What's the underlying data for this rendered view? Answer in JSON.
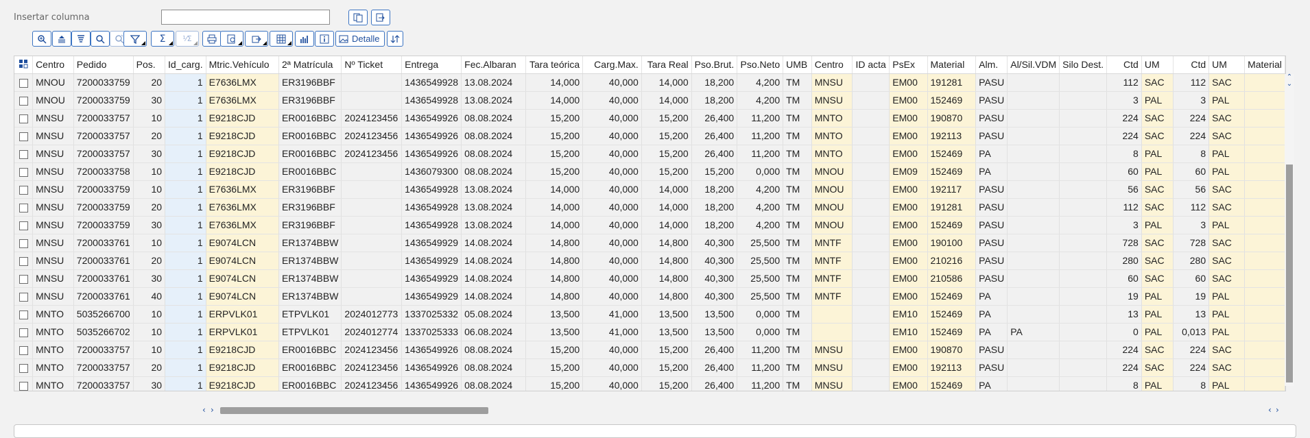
{
  "toolbar": {
    "insert_column_label": "Insertar columna",
    "insert_column_value": "",
    "detail_label": "Detalle"
  },
  "icons": {
    "copy_left": "copy-icon",
    "copy_right": "paste-icon",
    "zoom": "zoom-icon",
    "sort_asc": "sort-ascending-icon",
    "sort_desc": "sort-descending-icon",
    "find": "find-icon",
    "find_next": "find-next-icon",
    "filter": "filter-icon",
    "sum": "sum-icon",
    "subtotal": "subtotal-icon",
    "print": "print-icon",
    "print_preview": "print-preview-icon",
    "export": "export-icon",
    "layout": "layout-icon",
    "chart": "chart-icon",
    "info": "info-icon",
    "detail": "detail-icon",
    "more": "more-icon"
  },
  "grid": {
    "columns": [
      "Centro",
      "Pedido",
      "Pos.",
      "Id_carg.",
      "Mtric.Vehículo",
      "2ª Matrícula",
      "Nº Ticket",
      "Entrega",
      "Fec.Albaran",
      "Tara teórica",
      "Carg.Max.",
      "Tara Real",
      "Pso.Brut.",
      "Pso.Neto",
      "UMB",
      "Centro",
      "ID acta",
      "PsEx",
      "Material",
      "Alm.",
      "Al/Sil.VDM",
      "Silo Dest.",
      "Ctd",
      "UM",
      "Ctd",
      "UM",
      "Material"
    ],
    "rows": [
      [
        "MNOU",
        "7200033759",
        "20",
        "1",
        "E7636LMX",
        "ER3196BBF",
        "",
        "1436549928",
        "13.08.2024",
        "14,000",
        "40,000",
        "14,000",
        "18,200",
        "4,200",
        "TM",
        "MNSU",
        "",
        "EM00",
        "191281",
        "PASU",
        "",
        "",
        "112",
        "SAC",
        "112",
        "SAC",
        ""
      ],
      [
        "MNOU",
        "7200033759",
        "30",
        "1",
        "E7636LMX",
        "ER3196BBF",
        "",
        "1436549928",
        "13.08.2024",
        "14,000",
        "40,000",
        "14,000",
        "18,200",
        "4,200",
        "TM",
        "MNSU",
        "",
        "EM00",
        "152469",
        "PASU",
        "",
        "",
        "3",
        "PAL",
        "3",
        "PAL",
        ""
      ],
      [
        "MNSU",
        "7200033757",
        "10",
        "1",
        "E9218CJD",
        "ER0016BBC",
        "2024123456",
        "1436549926",
        "08.08.2024",
        "15,200",
        "40,000",
        "15,200",
        "26,400",
        "11,200",
        "TM",
        "MNTO",
        "",
        "EM00",
        "190870",
        "PASU",
        "",
        "",
        "224",
        "SAC",
        "224",
        "SAC",
        ""
      ],
      [
        "MNSU",
        "7200033757",
        "20",
        "1",
        "E9218CJD",
        "ER0016BBC",
        "2024123456",
        "1436549926",
        "08.08.2024",
        "15,200",
        "40,000",
        "15,200",
        "26,400",
        "11,200",
        "TM",
        "MNTO",
        "",
        "EM00",
        "192113",
        "PASU",
        "",
        "",
        "224",
        "SAC",
        "224",
        "SAC",
        ""
      ],
      [
        "MNSU",
        "7200033757",
        "30",
        "1",
        "E9218CJD",
        "ER0016BBC",
        "2024123456",
        "1436549926",
        "08.08.2024",
        "15,200",
        "40,000",
        "15,200",
        "26,400",
        "11,200",
        "TM",
        "MNTO",
        "",
        "EM00",
        "152469",
        "PA",
        "",
        "",
        "8",
        "PAL",
        "8",
        "PAL",
        ""
      ],
      [
        "MNSU",
        "7200033758",
        "10",
        "1",
        "E9218CJD",
        "ER0016BBC",
        "",
        "1436079300",
        "08.08.2024",
        "15,200",
        "40,000",
        "15,200",
        "15,200",
        "0,000",
        "TM",
        "MNOU",
        "",
        "EM09",
        "152469",
        "PA",
        "",
        "",
        "60",
        "PAL",
        "60",
        "PAL",
        ""
      ],
      [
        "MNSU",
        "7200033759",
        "10",
        "1",
        "E7636LMX",
        "ER3196BBF",
        "",
        "1436549928",
        "13.08.2024",
        "14,000",
        "40,000",
        "14,000",
        "18,200",
        "4,200",
        "TM",
        "MNOU",
        "",
        "EM00",
        "192117",
        "PASU",
        "",
        "",
        "56",
        "SAC",
        "56",
        "SAC",
        ""
      ],
      [
        "MNSU",
        "7200033759",
        "20",
        "1",
        "E7636LMX",
        "ER3196BBF",
        "",
        "1436549928",
        "13.08.2024",
        "14,000",
        "40,000",
        "14,000",
        "18,200",
        "4,200",
        "TM",
        "MNOU",
        "",
        "EM00",
        "191281",
        "PASU",
        "",
        "",
        "112",
        "SAC",
        "112",
        "SAC",
        ""
      ],
      [
        "MNSU",
        "7200033759",
        "30",
        "1",
        "E7636LMX",
        "ER3196BBF",
        "",
        "1436549928",
        "13.08.2024",
        "14,000",
        "40,000",
        "14,000",
        "18,200",
        "4,200",
        "TM",
        "MNOU",
        "",
        "EM00",
        "152469",
        "PASU",
        "",
        "",
        "3",
        "PAL",
        "3",
        "PAL",
        ""
      ],
      [
        "MNSU",
        "7200033761",
        "10",
        "1",
        "E9074LCN",
        "ER1374BBW",
        "",
        "1436549929",
        "14.08.2024",
        "14,800",
        "40,000",
        "14,800",
        "40,300",
        "25,500",
        "TM",
        "MNTF",
        "",
        "EM00",
        "190100",
        "PASU",
        "",
        "",
        "728",
        "SAC",
        "728",
        "SAC",
        ""
      ],
      [
        "MNSU",
        "7200033761",
        "20",
        "1",
        "E9074LCN",
        "ER1374BBW",
        "",
        "1436549929",
        "14.08.2024",
        "14,800",
        "40,000",
        "14,800",
        "40,300",
        "25,500",
        "TM",
        "MNTF",
        "",
        "EM00",
        "210216",
        "PASU",
        "",
        "",
        "280",
        "SAC",
        "280",
        "SAC",
        ""
      ],
      [
        "MNSU",
        "7200033761",
        "30",
        "1",
        "E9074LCN",
        "ER1374BBW",
        "",
        "1436549929",
        "14.08.2024",
        "14,800",
        "40,000",
        "14,800",
        "40,300",
        "25,500",
        "TM",
        "MNTF",
        "",
        "EM00",
        "210586",
        "PASU",
        "",
        "",
        "60",
        "SAC",
        "60",
        "SAC",
        ""
      ],
      [
        "MNSU",
        "7200033761",
        "40",
        "1",
        "E9074LCN",
        "ER1374BBW",
        "",
        "1436549929",
        "14.08.2024",
        "14,800",
        "40,000",
        "14,800",
        "40,300",
        "25,500",
        "TM",
        "MNTF",
        "",
        "EM00",
        "152469",
        "PA",
        "",
        "",
        "19",
        "PAL",
        "19",
        "PAL",
        ""
      ],
      [
        "MNTO",
        "5035266700",
        "10",
        "1",
        "ERPVLK01",
        "ETPVLK01",
        "2024012773",
        "1337025332",
        "05.08.2024",
        "13,500",
        "41,000",
        "13,500",
        "13,500",
        "0,000",
        "TM",
        "",
        "",
        "EM10",
        "152469",
        "PA",
        "",
        "",
        "13",
        "PAL",
        "13",
        "PAL",
        ""
      ],
      [
        "MNTO",
        "5035266702",
        "10",
        "1",
        "ERPVLK01",
        "ETPVLK01",
        "2024012774",
        "1337025333",
        "06.08.2024",
        "13,500",
        "41,000",
        "13,500",
        "13,500",
        "0,000",
        "TM",
        "",
        "",
        "EM10",
        "152469",
        "PA",
        "PA",
        "",
        "0",
        "PAL",
        "0,013",
        "PAL",
        ""
      ],
      [
        "MNTO",
        "7200033757",
        "10",
        "1",
        "E9218CJD",
        "ER0016BBC",
        "2024123456",
        "1436549926",
        "08.08.2024",
        "15,200",
        "40,000",
        "15,200",
        "26,400",
        "11,200",
        "TM",
        "MNSU",
        "",
        "EM00",
        "190870",
        "PASU",
        "",
        "",
        "224",
        "SAC",
        "224",
        "SAC",
        ""
      ],
      [
        "MNTO",
        "7200033757",
        "20",
        "1",
        "E9218CJD",
        "ER0016BBC",
        "2024123456",
        "1436549926",
        "08.08.2024",
        "15,200",
        "40,000",
        "15,200",
        "26,400",
        "11,200",
        "TM",
        "MNSU",
        "",
        "EM00",
        "192113",
        "PASU",
        "",
        "",
        "224",
        "SAC",
        "224",
        "SAC",
        ""
      ],
      [
        "MNTO",
        "7200033757",
        "30",
        "1",
        "E9218CJD",
        "ER0016BBC",
        "2024123456",
        "1436549926",
        "08.08.2024",
        "15,200",
        "40,000",
        "15,200",
        "26,400",
        "11,200",
        "TM",
        "MNSU",
        "",
        "EM00",
        "152469",
        "PA",
        "",
        "",
        "8",
        "PAL",
        "8",
        "PAL",
        ""
      ]
    ]
  }
}
